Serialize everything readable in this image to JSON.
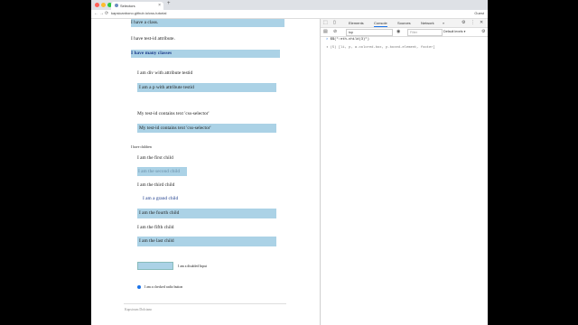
{
  "browser": {
    "tab_title": "Selectors",
    "new_tab_symbol": "+",
    "tab_close_symbol": "×",
    "url": "kapsicanbono.github.io/css-tutorial",
    "profile": "Guest",
    "back": "←",
    "forward": "→",
    "reload": "⟳"
  },
  "page": {
    "items": {
      "class": "I have a class.",
      "test_id_attr": "I have test-id attribute.",
      "many_classes": "I have many classes",
      "div_testid": "I am div with attribute testid",
      "p_testid": "I am a p with attribute testid",
      "contains1": "My test-id contains text 'css-selector'",
      "contains2": "My test-id contains text 'css-selector'",
      "have_children": "I have children",
      "first": "I am the first child",
      "second": "I am the second child",
      "third": "I am the third child",
      "grand": "I am a grand child",
      "fourth": "I am the fourth child",
      "fifth": "I am the fifth child",
      "last": "I am the last child",
      "disabled": "I am a disabled Input",
      "radio": "I am a checked radio button"
    },
    "footer": "Kapsicum Dolciano"
  },
  "devtools": {
    "tabs": [
      "Elements",
      "Console",
      "Sources",
      "Network"
    ],
    "more": "»",
    "context": "top",
    "filter_placeholder": "Filter",
    "levels": "Default levels ▾",
    "command": "$$(\":nth-child(3)\")",
    "result": "(5) [li, p, a.colored-box, p.boxed-element, footer]",
    "prompt": ">",
    "result_arrow": "◂"
  }
}
